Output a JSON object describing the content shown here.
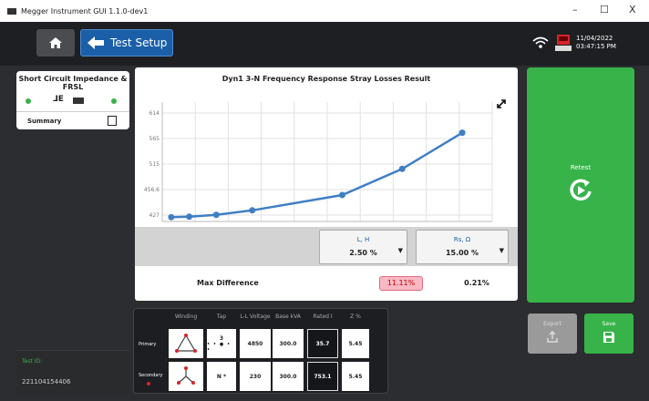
{
  "window": {
    "title": "Megger Instrument GUI 1.1.0-dev1",
    "minimize": "–",
    "maximize": "☐",
    "close": "X"
  },
  "nav": {
    "back_label": "Test Setup"
  },
  "status": {
    "date": "11/04/2022",
    "time": "03:47:15 PM"
  },
  "side": {
    "card_title": "Short Circuit Impedance & FRSL",
    "card_sub": "⅃E",
    "summary_label": "Summary",
    "test_id_label": "Test ID:",
    "test_id_value": "221104154406"
  },
  "chart": {
    "title": "Dyn1 3-N Frequency Response Stray Losses Result",
    "selectors": [
      {
        "label": "L, H",
        "value": "2.50 %"
      },
      {
        "label": "Rs, Ω",
        "value": "15.00 %"
      }
    ],
    "max_label": "Max Difference",
    "max_values": [
      "11.11%",
      "0.21%"
    ]
  },
  "chart_data": {
    "type": "line",
    "x": [
      15,
      45,
      90,
      150,
      300,
      400,
      500
    ],
    "y": [
      431.2,
      433.0,
      439.0,
      454.0,
      505.0,
      592.0,
      712.0
    ],
    "x_ticks": [
      "0.0",
      "15.0",
      "130.0",
      "185.0",
      "220.0",
      "275.0",
      "330.0",
      "385.0",
      "440.0",
      "495.0",
      "550.0"
    ],
    "y_ticks": [
      "427",
      "456.6",
      "515",
      "565",
      "614"
    ],
    "xlim": [
      0,
      550
    ],
    "ylim": [
      417,
      814
    ],
    "grid": true,
    "color": "#3f7fc4"
  },
  "winding": {
    "headers": [
      "Winding",
      "Tap",
      "L-L Voltage",
      "Base kVA",
      "Rated I",
      "Z %"
    ],
    "rows": [
      {
        "label": "Primary",
        "tap": "3",
        "voltage": "4850",
        "base": "300.0",
        "rated": "35.7",
        "z": "5.45"
      },
      {
        "label": "Secondary",
        "tap": "N *",
        "voltage": "230",
        "base": "300.0",
        "rated": "753.1",
        "z": "5.45"
      }
    ]
  },
  "actions": {
    "retest_label": "Retest",
    "export_label": "Export",
    "save_label": "Save"
  }
}
